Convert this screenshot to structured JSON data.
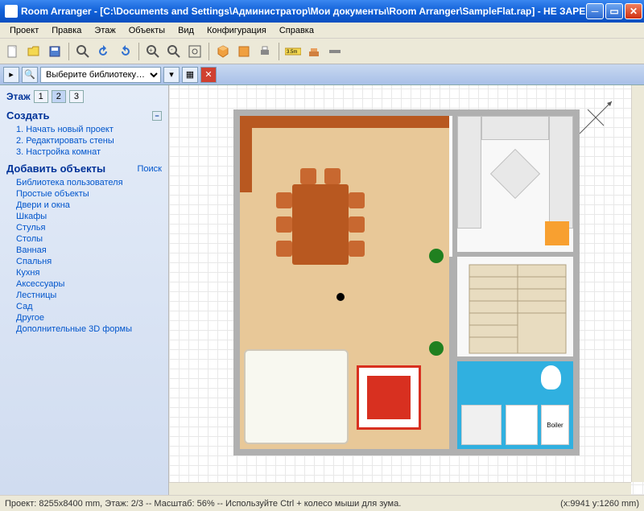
{
  "titlebar": {
    "text": "Room Arranger - [C:\\Documents and Settings\\Администратор\\Мои документы\\Room Arranger\\SampleFlat.rap] - НЕ ЗАРЕГИСТРИРО…"
  },
  "menu": {
    "items": [
      "Проект",
      "Правка",
      "Этаж",
      "Объекты",
      "Вид",
      "Конфигурация",
      "Справка"
    ]
  },
  "toolbar2": {
    "dropdown_placeholder": "Выберите библиотеку…"
  },
  "sidebar": {
    "floor_label": "Этаж",
    "floors": [
      "1",
      "2",
      "3"
    ],
    "active_floor": 1,
    "create_header": "Создать",
    "create_items": [
      "1. Начать новый проект",
      "2. Редактировать стены",
      "3. Настройка комнат"
    ],
    "objects_header": "Добавить объекты",
    "search_label": "Поиск",
    "object_categories": [
      "Библиотека пользователя",
      "Простые объекты",
      "Двери и окна",
      "Шкафы",
      "Стулья",
      "Столы",
      "Ванная",
      "Спальня",
      "Кухня",
      "Аксессуары",
      "Лестницы",
      "Сад",
      "Другое",
      "Дополнительные 3D формы"
    ]
  },
  "bath": {
    "boiler_label": "Boiler"
  },
  "statusbar": {
    "left": "Проект: 8255x8400 mm, Этаж: 2/3 -- Масштаб: 56% -- Используйте Ctrl + колесо мыши для зума.",
    "right": "(x:9941 y:1260 mm)"
  }
}
